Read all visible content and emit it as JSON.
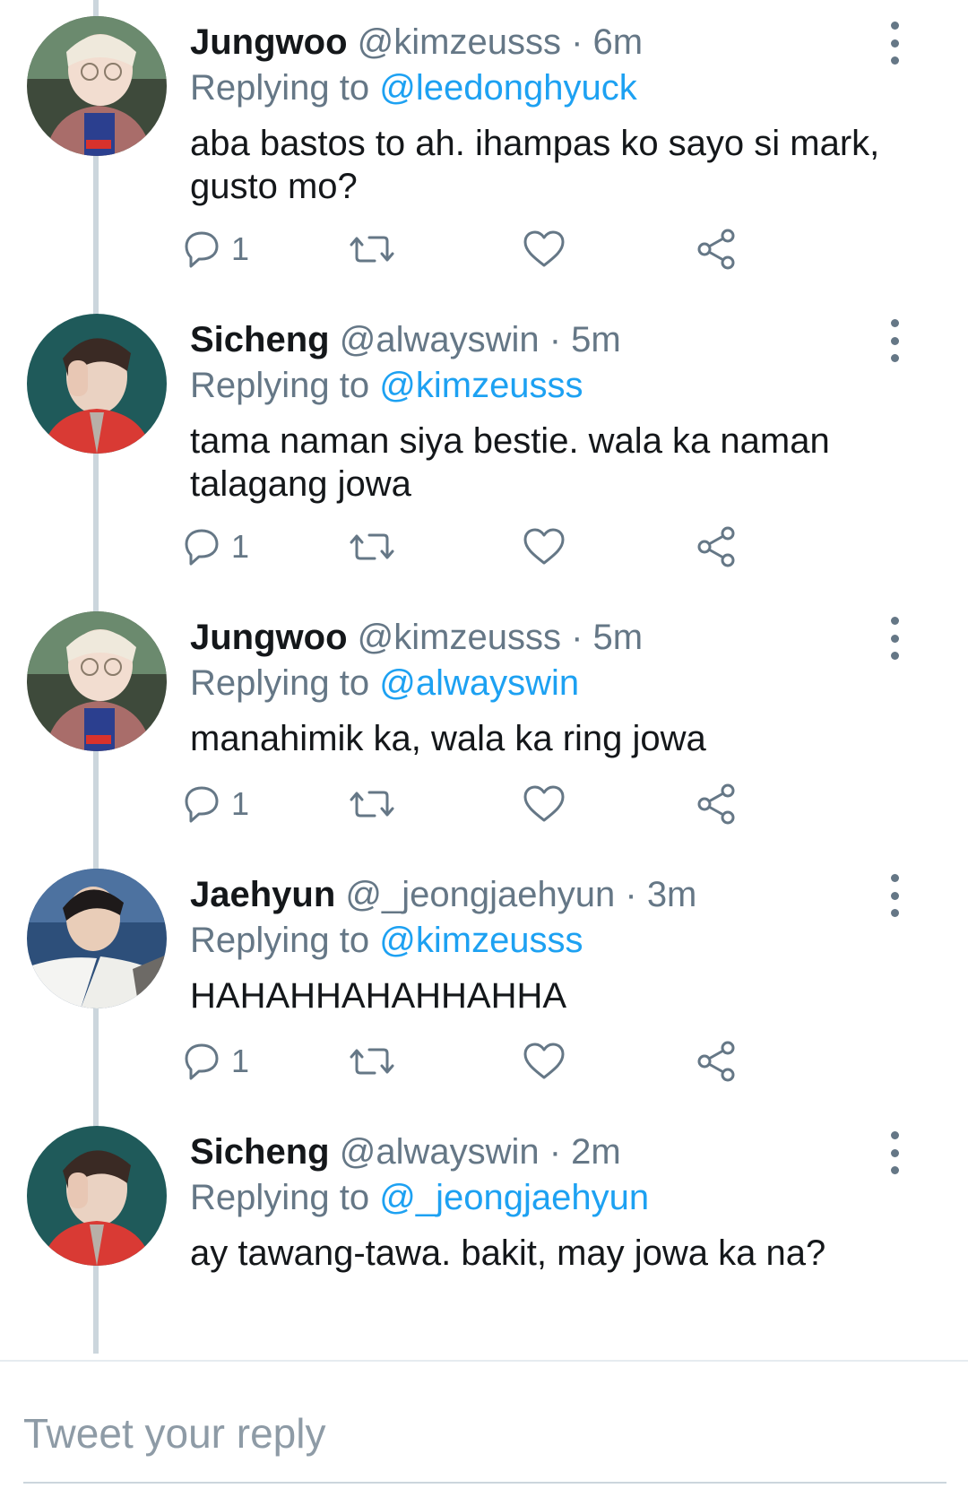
{
  "tweets": [
    {
      "name": "Jungwoo",
      "handle": "@kimzeusss",
      "time": "6m",
      "replying_label": "Replying to",
      "replying_to": "@leedonghyuck",
      "text": "aba bastos to ah. ihampas ko sayo si mark, gusto mo?",
      "reply_count": "1",
      "avatar": "avatar-jungwoo"
    },
    {
      "name": "Sicheng",
      "handle": "@alwayswin",
      "time": "5m",
      "replying_label": "Replying to",
      "replying_to": "@kimzeusss",
      "text": "tama naman siya bestie. wala ka naman talagang jowa",
      "reply_count": "1",
      "avatar": "avatar-sicheng"
    },
    {
      "name": "Jungwoo",
      "handle": "@kimzeusss",
      "time": "5m",
      "replying_label": "Replying to",
      "replying_to": "@alwayswin",
      "text": "manahimik ka, wala ka ring jowa",
      "reply_count": "1",
      "avatar": "avatar-jungwoo"
    },
    {
      "name": "Jaehyun",
      "handle": "@_jeongjaehyun",
      "time": "3m",
      "replying_label": "Replying to",
      "replying_to": "@kimzeusss",
      "text": "HAHAHHAHAHHAHHA",
      "reply_count": "1",
      "avatar": "avatar-jaehyun"
    },
    {
      "name": "Sicheng",
      "handle": "@alwayswin",
      "time": "2m",
      "replying_label": "Replying to",
      "replying_to": "@_jeongjaehyun",
      "text": "ay tawang-tawa. bakit, may jowa ka na?",
      "avatar": "avatar-sicheng"
    }
  ],
  "separator": " · ",
  "composer": {
    "placeholder": "Tweet your reply"
  },
  "icons": {
    "reply": "reply-icon",
    "retweet": "retweet-icon",
    "like": "heart-icon",
    "share": "share-icon",
    "more": "more-vertical-icon"
  },
  "colors": {
    "link": "#1da1f2",
    "secondary_text": "#657786",
    "primary_text": "#14171a",
    "thread_line": "#ccd6dd"
  }
}
